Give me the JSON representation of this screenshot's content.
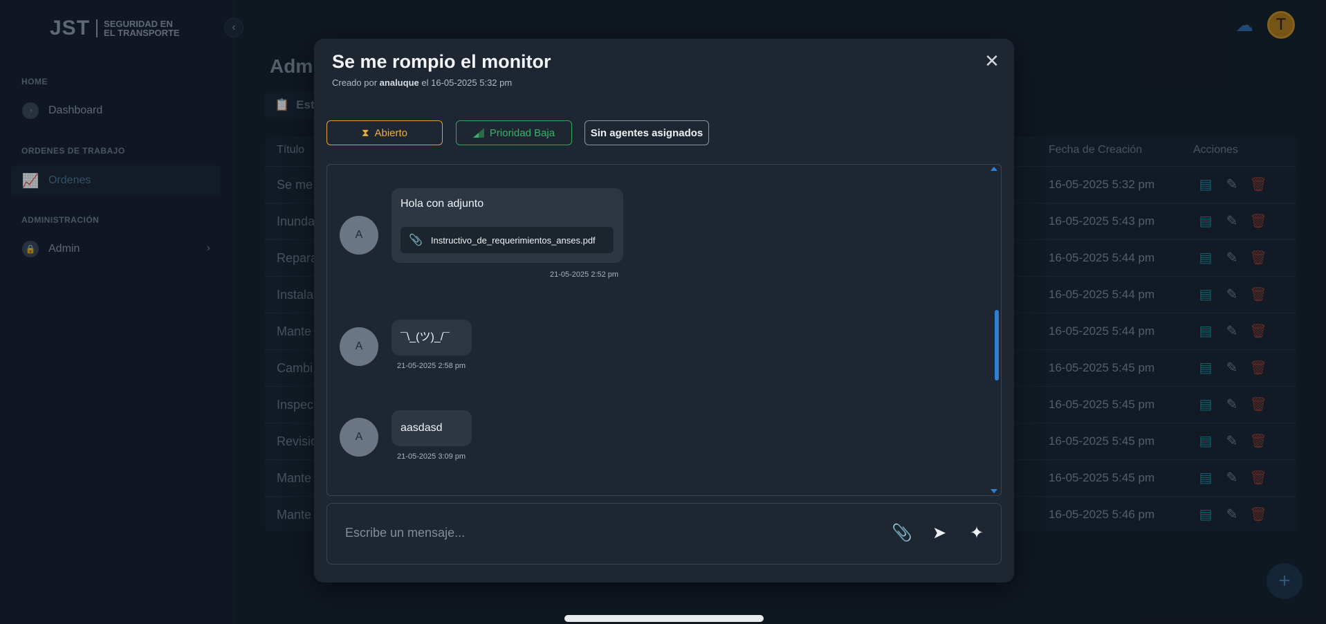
{
  "brand": {
    "mark": "JST",
    "line1": "SEGURIDAD EN",
    "line2": "EL TRANSPORTE"
  },
  "sidebar": {
    "collapse_icon": "chevron-left-icon",
    "sections": [
      {
        "label": "HOME",
        "items": [
          {
            "label": "Dashboard",
            "icon": "gauge-icon"
          }
        ]
      },
      {
        "label": "ORDENES DE TRABAJO",
        "items": [
          {
            "label": "Ordenes",
            "icon": "chart-icon"
          }
        ]
      },
      {
        "label": "ADMINISTRACIÓN",
        "items": [
          {
            "label": "Admin",
            "icon": "lock-icon"
          }
        ]
      }
    ]
  },
  "topbar": {
    "theme_icon": "moon-icon",
    "avatar_initial": "T"
  },
  "page": {
    "title": "Admi",
    "filter_label": "Esta",
    "table": {
      "headers": {
        "title": "Título",
        "created": "Fecha de Creación",
        "actions": "Acciones"
      },
      "rows": [
        {
          "title": "Se me",
          "date": "16-05-2025 5:32 pm"
        },
        {
          "title": "Inunda",
          "date": "16-05-2025 5:43 pm"
        },
        {
          "title": "Repara",
          "date": "16-05-2025 5:44 pm"
        },
        {
          "title": "Instala",
          "date": "16-05-2025 5:44 pm"
        },
        {
          "title": "Mante",
          "date": "16-05-2025 5:44 pm"
        },
        {
          "title": "Cambi",
          "date": "16-05-2025 5:45 pm"
        },
        {
          "title": "Inspec",
          "date": "16-05-2025 5:45 pm"
        },
        {
          "title": "Revisio",
          "date": "16-05-2025 5:45 pm"
        },
        {
          "title": "Mante",
          "date": "16-05-2025 5:45 pm"
        },
        {
          "title": "Mante",
          "date": "16-05-2025 5:46 pm"
        }
      ]
    },
    "fab_label": "+"
  },
  "modal": {
    "title": "Se me rompio el monitor",
    "sub_prefix": "Creado por",
    "author": "analuque",
    "sub_mid": "el",
    "created_at": "16-05-2025 5:32 pm",
    "status": "Abierto",
    "priority": "Prioridad Baja",
    "agents": "Sin agentes asignados",
    "status_color": "#f0ae3c",
    "priority_color": "#35b469",
    "messages": [
      {
        "avatar": "A",
        "text": "Hola con adjunto",
        "attachment": "Instructivo_de_requerimientos_anses.pdf",
        "time": "21-05-2025 2:52 pm"
      },
      {
        "avatar": "A",
        "text": "¯\\_(ツ)_/¯",
        "time": "21-05-2025 2:58 pm"
      },
      {
        "avatar": "A",
        "text": "aasdasd",
        "time": "21-05-2025 3:09 pm"
      }
    ],
    "composer_placeholder": "Escribe un mensaje..."
  }
}
